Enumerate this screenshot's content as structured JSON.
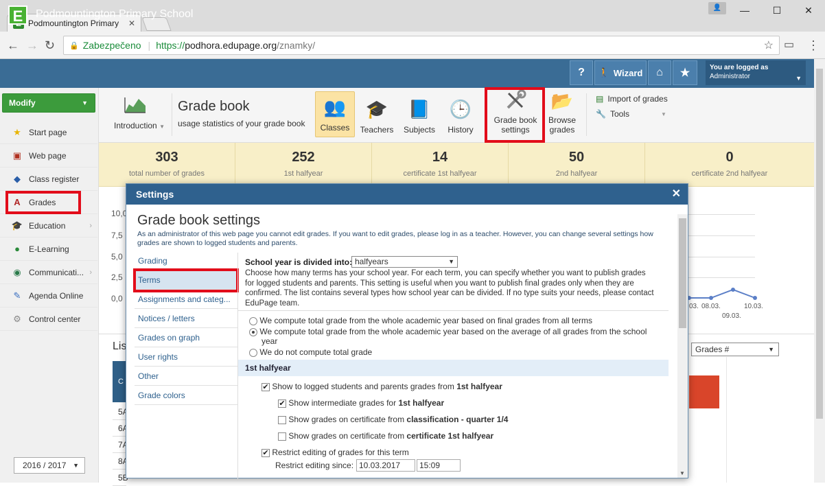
{
  "browser": {
    "tab_title": "Podmountington Primary",
    "secure_label": "Zabezpečeno",
    "url_scheme": "https://",
    "url_host": "podhora.edupage.org",
    "url_path": "/znamky/"
  },
  "app": {
    "school_name": "Podmountington Primary School",
    "logo_letter": "E",
    "help_label": "?",
    "wizard_label": "Wizard",
    "login_line1": "You are logged as",
    "login_line2": "Administrator"
  },
  "sidebar": {
    "modify_label": "Modify",
    "items": [
      {
        "label": "Start page",
        "icon": "star-icon"
      },
      {
        "label": "Web page",
        "icon": "web-page-icon"
      },
      {
        "label": "Class register",
        "icon": "book-icon"
      },
      {
        "label": "Grades",
        "icon": "grades-icon"
      },
      {
        "label": "Education",
        "icon": "education-icon"
      },
      {
        "label": "E-Learning",
        "icon": "e-learning-icon"
      },
      {
        "label": "Communicati...",
        "icon": "communication-icon"
      },
      {
        "label": "Agenda Online",
        "icon": "agenda-icon"
      },
      {
        "label": "Control center",
        "icon": "gear-icon"
      }
    ],
    "year": "2016 / 2017"
  },
  "ribbon": {
    "intro_label": "Introduction",
    "title": "Grade book",
    "subtitle": "usage statistics of your grade book",
    "classes": "Classes",
    "teachers": "Teachers",
    "subjects": "Subjects",
    "history": "History",
    "settings_line1": "Grade book",
    "settings_line2": "settings",
    "browse_line1": "Browse",
    "browse_line2": "grades",
    "import_label": "Import of grades",
    "tools_label": "Tools"
  },
  "stats": [
    {
      "value": "303",
      "label": "total number of grades"
    },
    {
      "value": "252",
      "label": "1st halfyear"
    },
    {
      "value": "14",
      "label": "certificate 1st halfyear"
    },
    {
      "value": "50",
      "label": "2nd halfyear"
    },
    {
      "value": "0",
      "label": "certificate 2nd halfyear"
    }
  ],
  "background": {
    "y_labels": [
      "10,0",
      "7,5",
      "5,0",
      "2,5",
      "0,0"
    ],
    "date_labels": [
      "03.",
      "08.03.",
      "10.03.",
      "09.03."
    ],
    "list_label": "Lis",
    "grades_select": "Grades #",
    "rows": [
      "5A",
      "6A",
      "7A",
      "8A",
      "5B"
    ],
    "col_head": "C"
  },
  "modal": {
    "header": "Settings",
    "title": "Grade book settings",
    "description": "As an administrator of this web page you cannot edit grades. If you want to edit grades, please log in as a teacher. However, you can change several settings how grades are shown to logged students and parents.",
    "nav": [
      "Grading",
      "Terms",
      "Assignments and categ...",
      "Notices / letters",
      "Grades on graph",
      "User rights",
      "Other",
      "Grade colors"
    ],
    "school_year_label": "School year is divided into:",
    "school_year_value": "halfyears",
    "school_year_desc": "Choose how many terms has your school year. For each term, you can specify whether you want to publish grades for logged students and parents. This setting is useful when you want to publish final grades only when they are confirmed. The list contains several types how school year can be divided. If no type suits your needs, please contact EduPage team.",
    "radio1": "We compute total grade from the whole academic year based on final grades from all terms",
    "radio2": "We compute total grade from the whole academic year based on the average of all grades from the school year",
    "radio3": "We do not compute total grade",
    "section": "1st halfyear",
    "chk_show_prefix": "Show to logged students and parents grades from ",
    "chk_show_bold": "1st halfyear",
    "chk_inter_prefix": "Show intermediate grades for ",
    "chk_inter_bold": "1st halfyear",
    "chk_class_prefix": "Show grades on certificate from ",
    "chk_class_bold": "classification - quarter 1/4",
    "chk_cert_prefix": "Show grades on certificate from ",
    "chk_cert_bold": "certificate 1st halfyear",
    "chk_restrict": "Restrict editing of grades for this term",
    "restrict_since_label": "Restrict editing since:",
    "restrict_date": "10.03.2017",
    "restrict_time": "15:09"
  },
  "colors": {
    "header_blue": "#3a6c95",
    "modal_blue": "#2f618e",
    "green": "#3c9b3c",
    "stats_bg": "#f8efc8",
    "highlight_red": "#e20c1a"
  }
}
